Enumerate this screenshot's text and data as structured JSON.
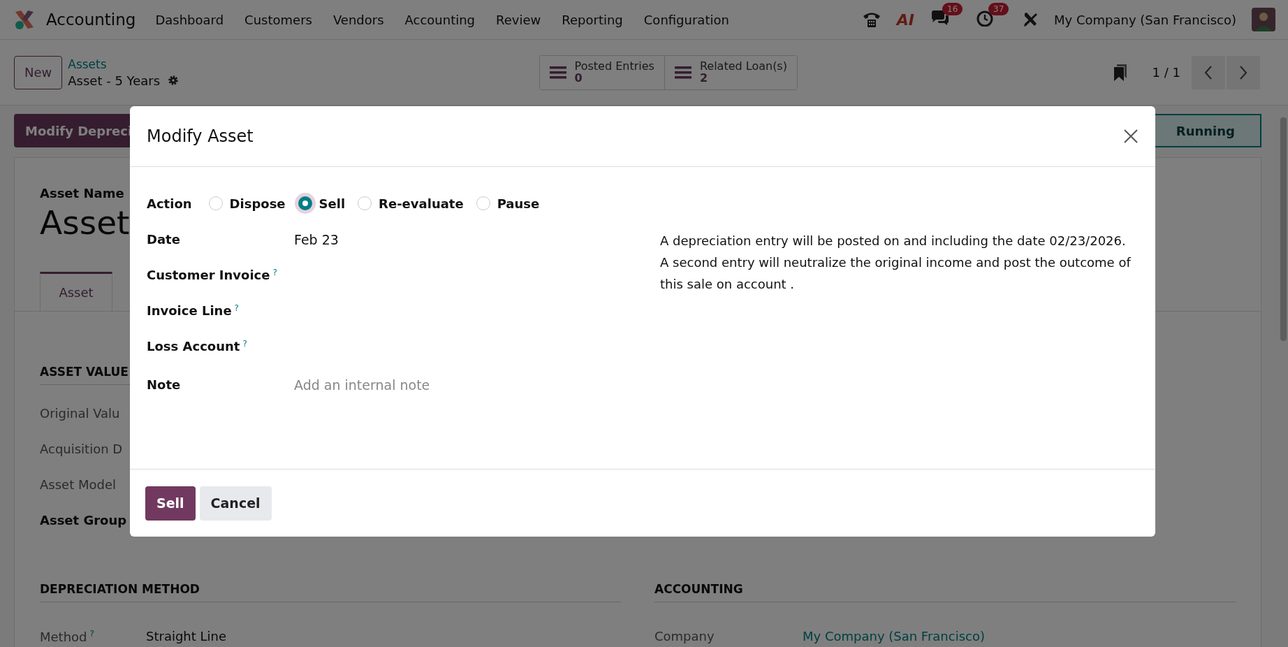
{
  "navbar": {
    "app_name": "Accounting",
    "menu_items": [
      {
        "label": "Dashboard"
      },
      {
        "label": "Customers"
      },
      {
        "label": "Vendors"
      },
      {
        "label": "Accounting"
      },
      {
        "label": "Review"
      },
      {
        "label": "Reporting"
      },
      {
        "label": "Configuration"
      }
    ],
    "ai_label": "AI",
    "notifications": [
      {
        "kind": "chat",
        "badge": "16"
      },
      {
        "kind": "activity",
        "badge": "37"
      }
    ],
    "company": "My Company (San Francisco)"
  },
  "control_panel": {
    "new_button": "New",
    "breadcrumb": {
      "parent": "Assets",
      "current": "Asset - 5 Years"
    },
    "smart_buttons": [
      {
        "label": "Posted Entries",
        "value": "0"
      },
      {
        "label": "Related Loan(s)",
        "value": "2"
      }
    ],
    "pager": "1 / 1"
  },
  "status_bar": {
    "action_button": "Modify Depreci",
    "stages": [
      {
        "label": "Running",
        "selected": true
      }
    ]
  },
  "form": {
    "name_label": "Asset Name",
    "name": "Asset",
    "tabs": [
      {
        "label": "Asset",
        "selected": true
      }
    ],
    "asset_value": {
      "title": "ASSET VALUE",
      "rows": [
        {
          "label": "Original Valu",
          "bold": false
        },
        {
          "label": "Acquisition D",
          "bold": false
        },
        {
          "label": "Asset Model",
          "bold": false
        },
        {
          "label": "Asset Group",
          "bold": true
        }
      ]
    },
    "depreciation_method": {
      "title": "DEPRECIATION METHOD",
      "rows": [
        {
          "label": "Method",
          "help": "?",
          "value": "Straight Line",
          "link": false
        }
      ]
    },
    "accounting": {
      "title": "ACCOUNTING",
      "rows": [
        {
          "label": "Company",
          "value": "My Company (San Francisco)",
          "link": true
        }
      ]
    }
  },
  "dialog": {
    "title": "Modify Asset",
    "action": {
      "label": "Action",
      "options": [
        {
          "label": "Dispose",
          "selected": false
        },
        {
          "label": "Sell",
          "selected": true
        },
        {
          "label": "Re-evaluate",
          "selected": false
        },
        {
          "label": "Pause",
          "selected": false
        }
      ]
    },
    "fields": [
      {
        "label": "Date",
        "value": "Feb 23"
      },
      {
        "label": "Customer Invoice",
        "help": "?"
      },
      {
        "label": "Invoice Line",
        "help": "?"
      },
      {
        "label": "Loss Account",
        "help": "?"
      },
      {
        "label": "Note",
        "placeholder": "Add an internal note"
      }
    ],
    "info": [
      "A depreciation entry will be posted on and including the date 02/23/2026.",
      "A second entry will neutralize the original income and post the outcome of this sale on account ."
    ],
    "buttons": [
      {
        "label": "Sell",
        "kind": "primary"
      },
      {
        "label": "Cancel",
        "kind": "secondary"
      }
    ]
  }
}
